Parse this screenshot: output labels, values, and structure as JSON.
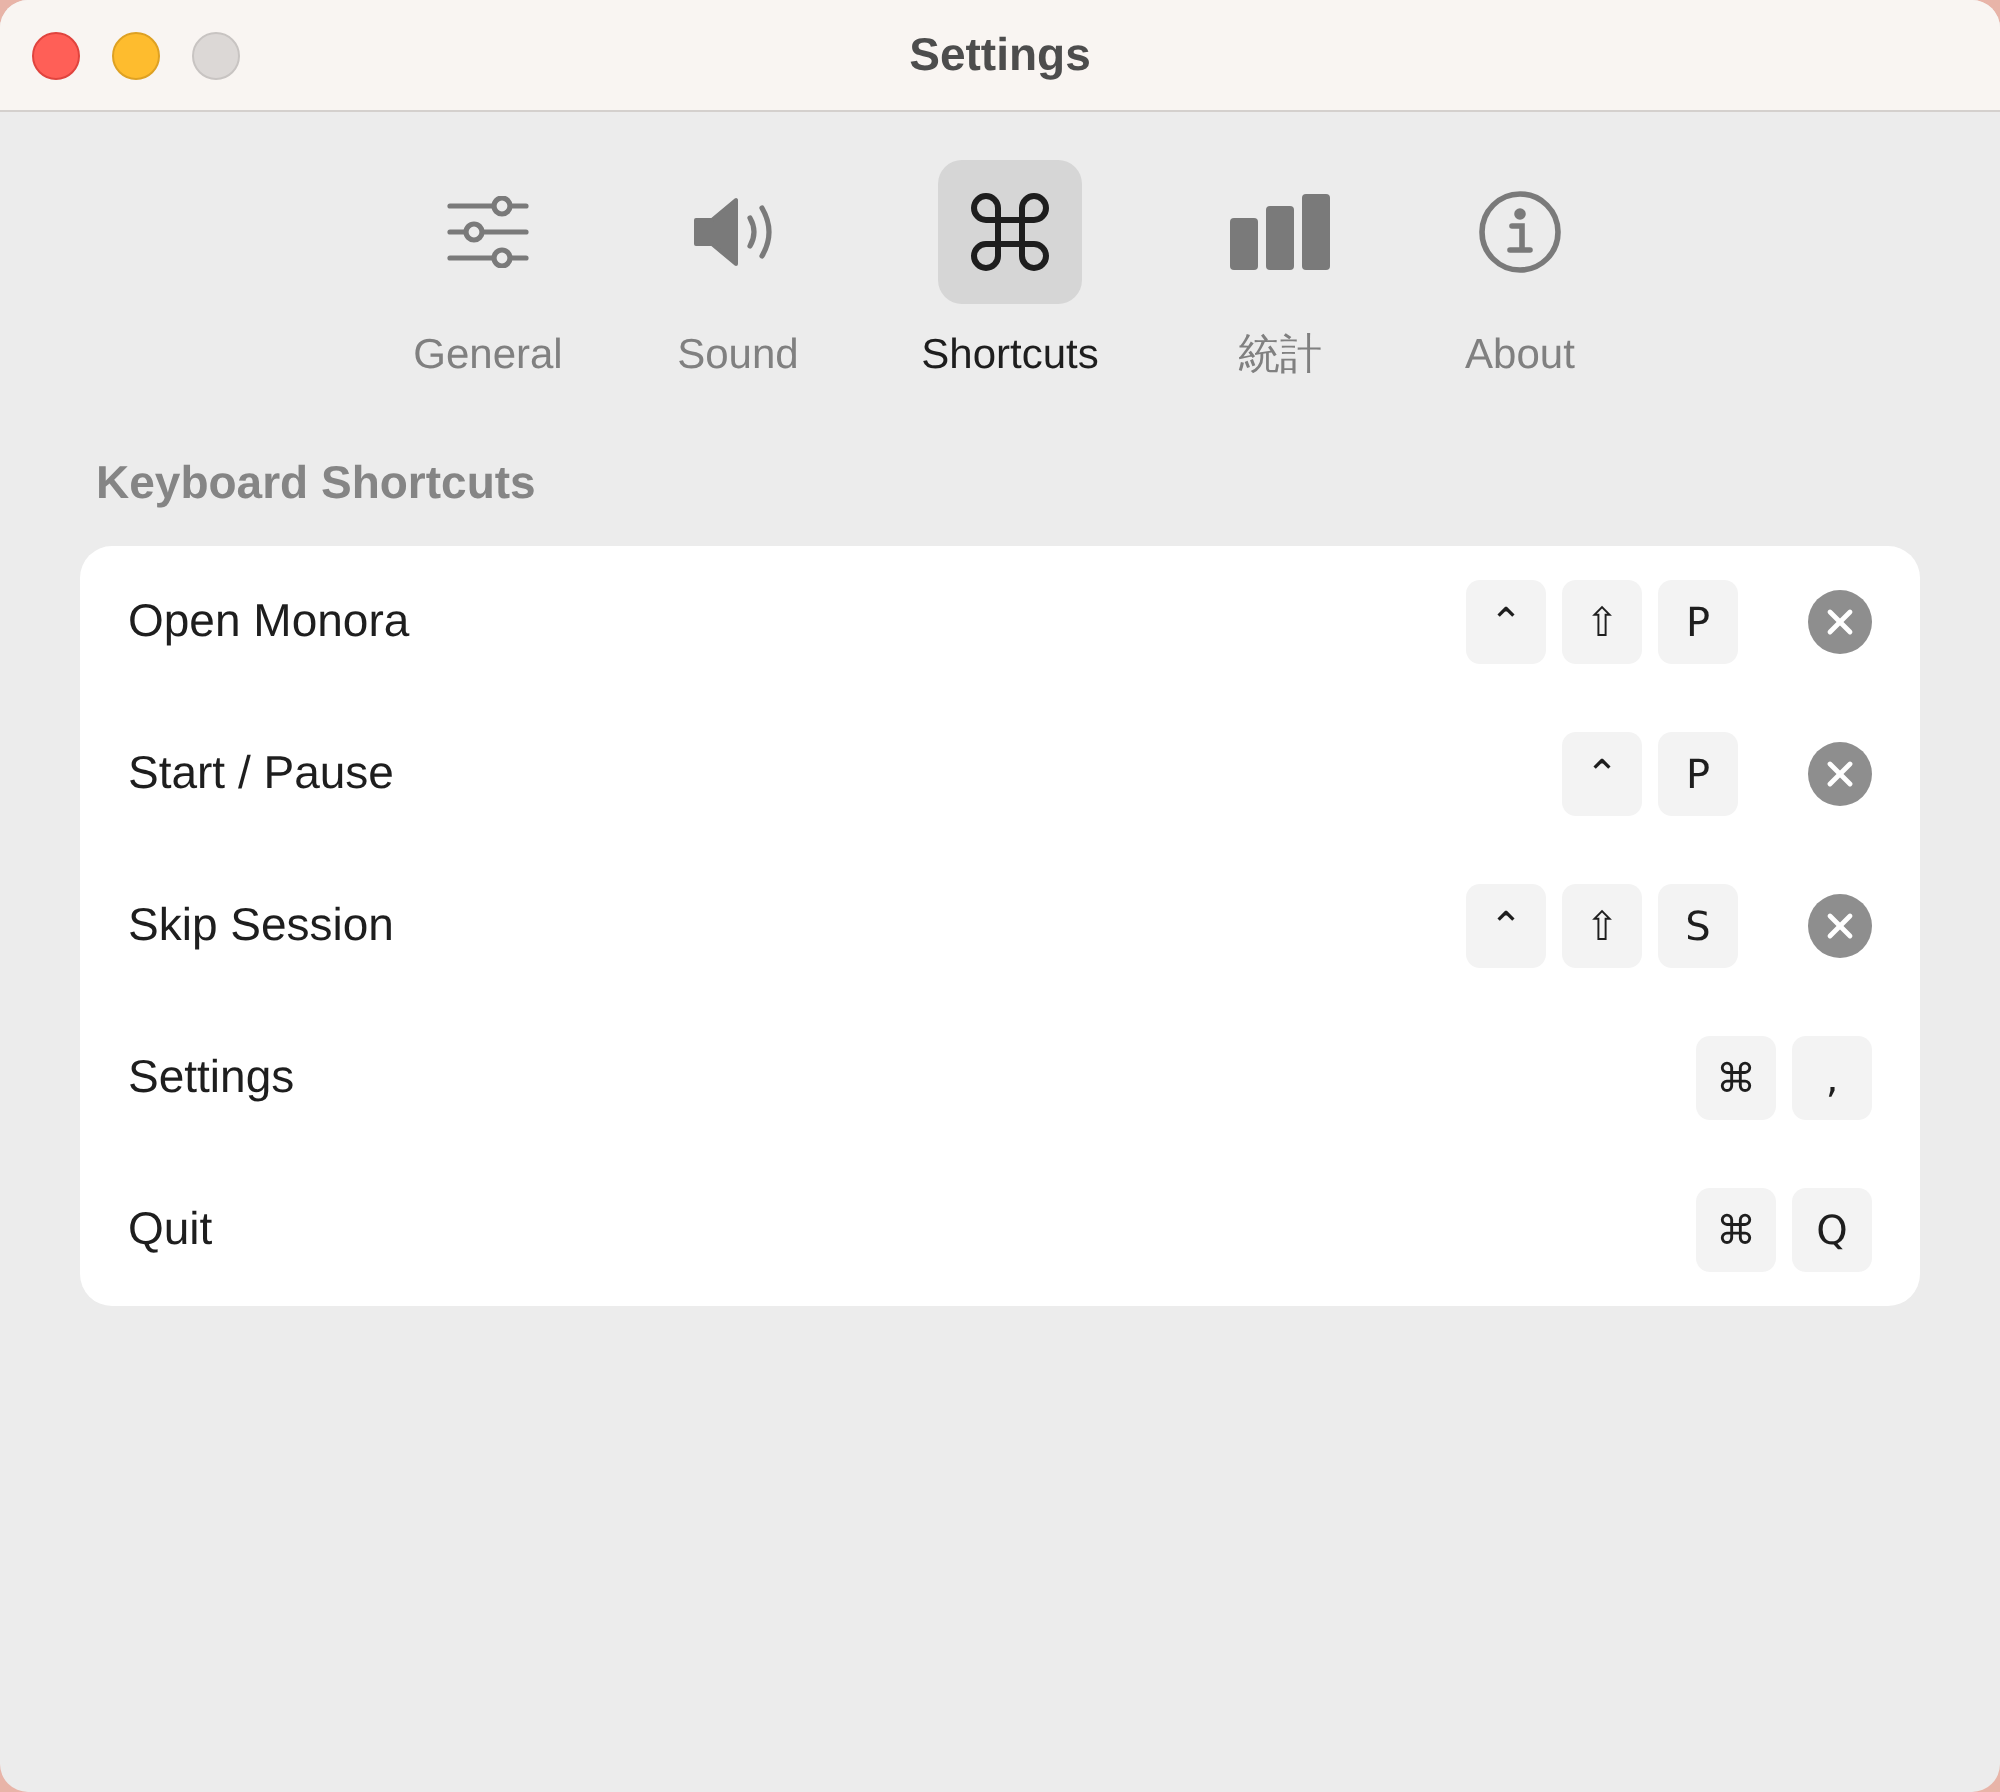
{
  "window": {
    "title": "Settings"
  },
  "tabs": [
    {
      "kind": "general",
      "label": "General",
      "selected": false
    },
    {
      "kind": "sound",
      "label": "Sound",
      "selected": false
    },
    {
      "kind": "shortcuts",
      "label": "Shortcuts",
      "selected": true
    },
    {
      "kind": "stats",
      "label": "統計",
      "selected": false
    },
    {
      "kind": "about",
      "label": "About",
      "selected": false
    }
  ],
  "section": {
    "title": "Keyboard Shortcuts"
  },
  "shortcuts": [
    {
      "name": "Open Monora",
      "keys": [
        "⌃",
        "⇧",
        "P"
      ],
      "clearable": true
    },
    {
      "name": "Start / Pause",
      "keys": [
        "⌃",
        "P"
      ],
      "clearable": true
    },
    {
      "name": "Skip Session",
      "keys": [
        "⌃",
        "⇧",
        "S"
      ],
      "clearable": true
    },
    {
      "name": "Settings",
      "keys": [
        "⌘",
        ","
      ],
      "clearable": false
    },
    {
      "name": "Quit",
      "keys": [
        "⌘",
        "Q"
      ],
      "clearable": false
    }
  ]
}
